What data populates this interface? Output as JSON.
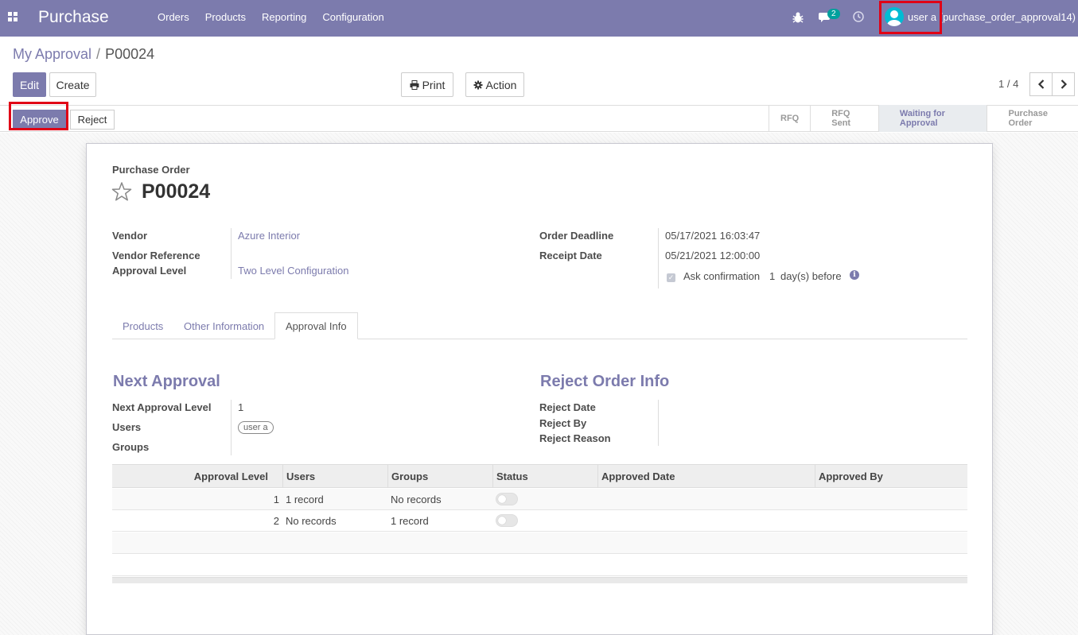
{
  "navbar": {
    "brand": "Purchase",
    "menu": [
      "Orders",
      "Products",
      "Reporting",
      "Configuration"
    ],
    "chat_count": "2",
    "user_label": "user a (purchase_order_approval14)"
  },
  "breadcrumb": {
    "parent": "My Approval",
    "separator": "/",
    "current": "P00024"
  },
  "toolbar": {
    "edit": "Edit",
    "create": "Create",
    "print": "Print",
    "action": "Action",
    "pager": "1 / 4"
  },
  "statusbar": {
    "approve": "Approve",
    "reject": "Reject",
    "stages": [
      "RFQ",
      "RFQ Sent",
      "Waiting for Approval",
      "Purchase Order"
    ],
    "active_stage": "Waiting for Approval"
  },
  "form": {
    "doc_label": "Purchase Order",
    "doc_name": "P00024",
    "vendor_label": "Vendor",
    "vendor_value": "Azure Interior",
    "vendor_ref_label": "Vendor Reference",
    "approval_level_label": "Approval Level",
    "approval_level_value": "Two Level Configuration",
    "order_deadline_label": "Order Deadline",
    "order_deadline_value": "05/17/2021 16:03:47",
    "receipt_date_label": "Receipt Date",
    "receipt_date_value": "05/21/2021 12:00:00",
    "ask_confirmation_prefix": "Ask confirmation",
    "ask_confirmation_days": "1",
    "ask_confirmation_suffix": "day(s) before"
  },
  "tabs": [
    "Products",
    "Other Information",
    "Approval Info"
  ],
  "active_tab": "Approval Info",
  "approval_info": {
    "next_title": "Next Approval",
    "next_level_label": "Next Approval Level",
    "next_level_value": "1",
    "users_label": "Users",
    "users_tag": "user a",
    "groups_label": "Groups",
    "reject_title": "Reject Order Info",
    "reject_date_label": "Reject Date",
    "reject_by_label": "Reject By",
    "reject_reason_label": "Reject Reason"
  },
  "table": {
    "headers": [
      "Approval Level",
      "Users",
      "Groups",
      "Status",
      "Approved Date",
      "Approved By"
    ],
    "rows": [
      {
        "level": "1",
        "users": "1 record",
        "groups": "No records",
        "approved_date": "",
        "approved_by": ""
      },
      {
        "level": "2",
        "users": "No records",
        "groups": "1 record",
        "approved_date": "",
        "approved_by": ""
      }
    ]
  },
  "colors": {
    "primary": "#7c7bad",
    "highlight": "#e00016",
    "badge": "#00a09d"
  }
}
